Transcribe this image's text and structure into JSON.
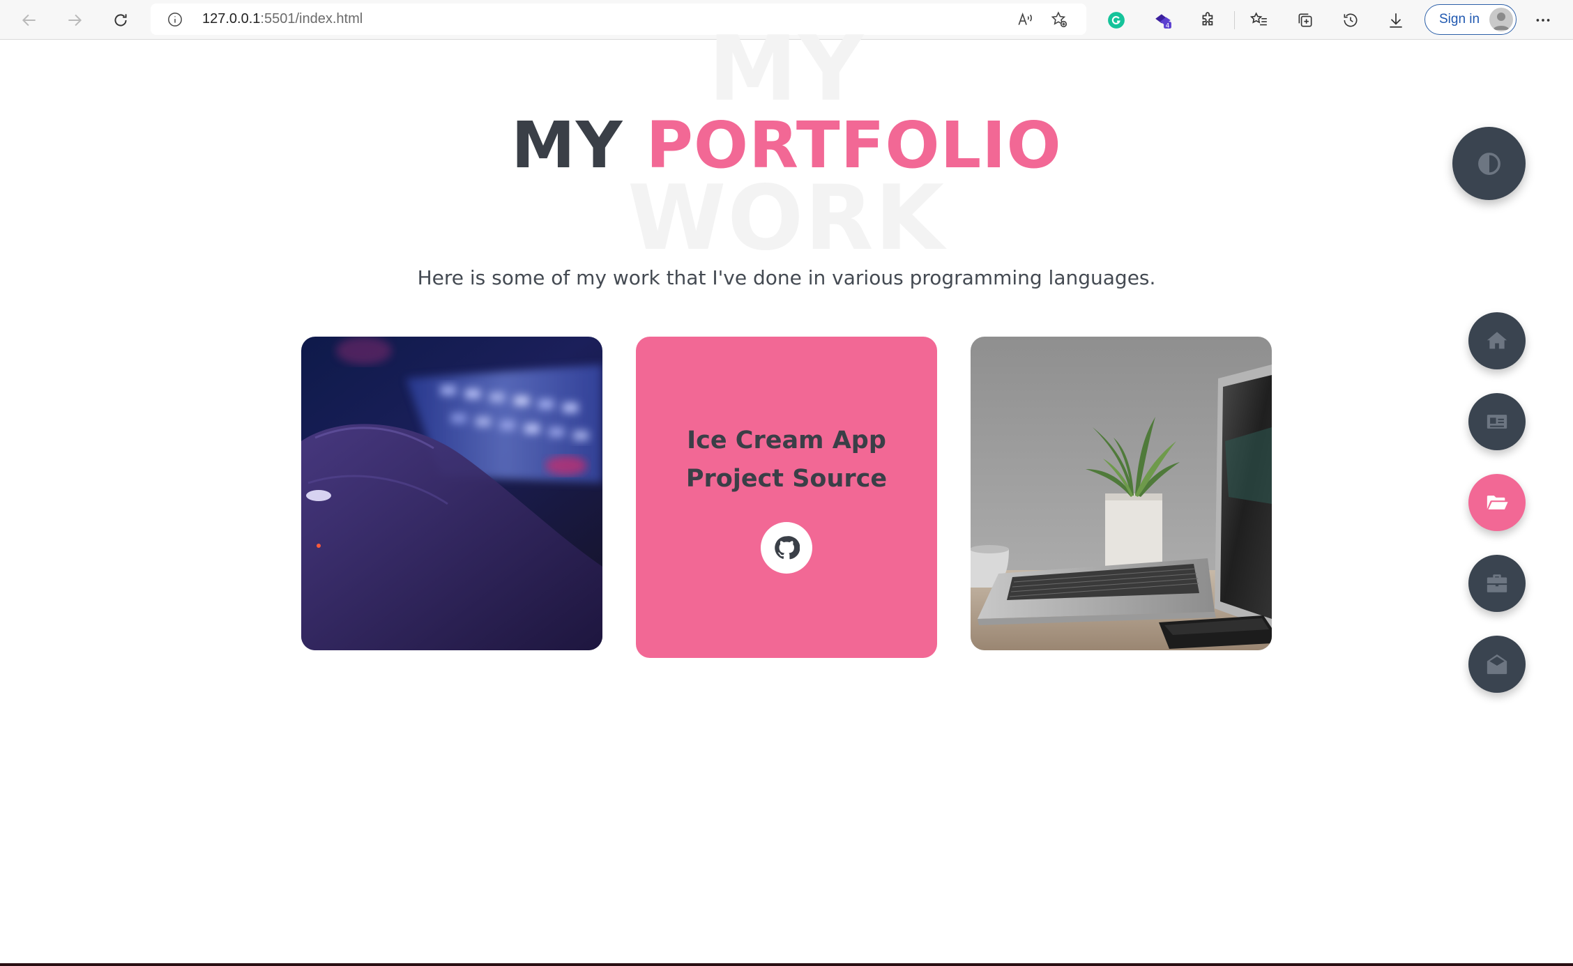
{
  "browser": {
    "url_host": "127.0.0.1",
    "url_rest": ":5501/index.html",
    "signin_label": "Sign in",
    "extension_badge": "4"
  },
  "page": {
    "bg_title_line1": "MY",
    "bg_title_line2": "WORK",
    "heading_dark": "MY",
    "heading_pink": "PORTFOLIO",
    "subtitle": "Here is some of my work that I've done in various programming languages."
  },
  "cards": [
    {
      "type": "image",
      "image": "hand-on-keyboard-photo"
    },
    {
      "type": "project",
      "title": "Ice Cream App Project Source",
      "icon": "github-icon"
    },
    {
      "type": "image",
      "image": "laptop-and-plant-photo"
    }
  ],
  "side_nav": {
    "theme_icon": "contrast-icon",
    "items": [
      {
        "name": "home",
        "icon": "home-icon",
        "active": false
      },
      {
        "name": "about",
        "icon": "id-card-icon",
        "active": false
      },
      {
        "name": "portfolio",
        "icon": "folder-open-icon",
        "active": true
      },
      {
        "name": "experience",
        "icon": "briefcase-icon",
        "active": false
      },
      {
        "name": "contact",
        "icon": "envelope-open-icon",
        "active": false
      }
    ]
  },
  "colors": {
    "accent": "#f26895",
    "dark": "#3a3f47",
    "nav_bg": "#3a4450"
  }
}
